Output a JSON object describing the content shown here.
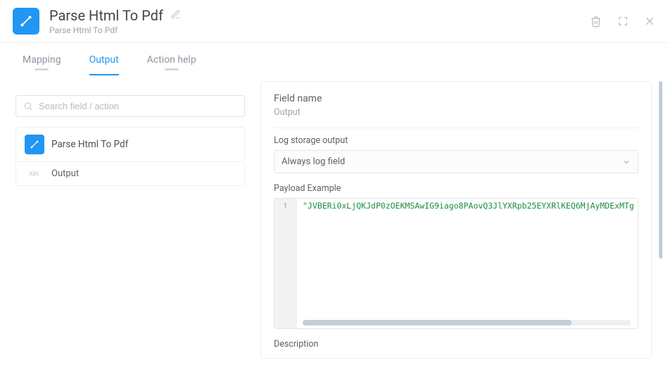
{
  "header": {
    "title": "Parse Html To Pdf",
    "subtitle": "Parse Html To Pdf"
  },
  "tabs": {
    "mapping": "Mapping",
    "output": "Output",
    "action_help": "Action help"
  },
  "search": {
    "placeholder": "Search field / action"
  },
  "tree": {
    "root_label": "Parse Html To Pdf",
    "child_badge": "ABC",
    "child_label": "Output"
  },
  "panel": {
    "field_name_label": "Field name",
    "field_name_value": "Output",
    "log_label": "Log storage output",
    "log_value": "Always log field",
    "payload_label": "Payload Example",
    "code_line_no": "1",
    "code_line": "\"JVBERi0xLjQKJdP0zOEKMSAwIG9iago8PAovQ3JlYXRpb25EYXRlKEQ6MjAyMDExMTg",
    "description_label": "Description"
  }
}
